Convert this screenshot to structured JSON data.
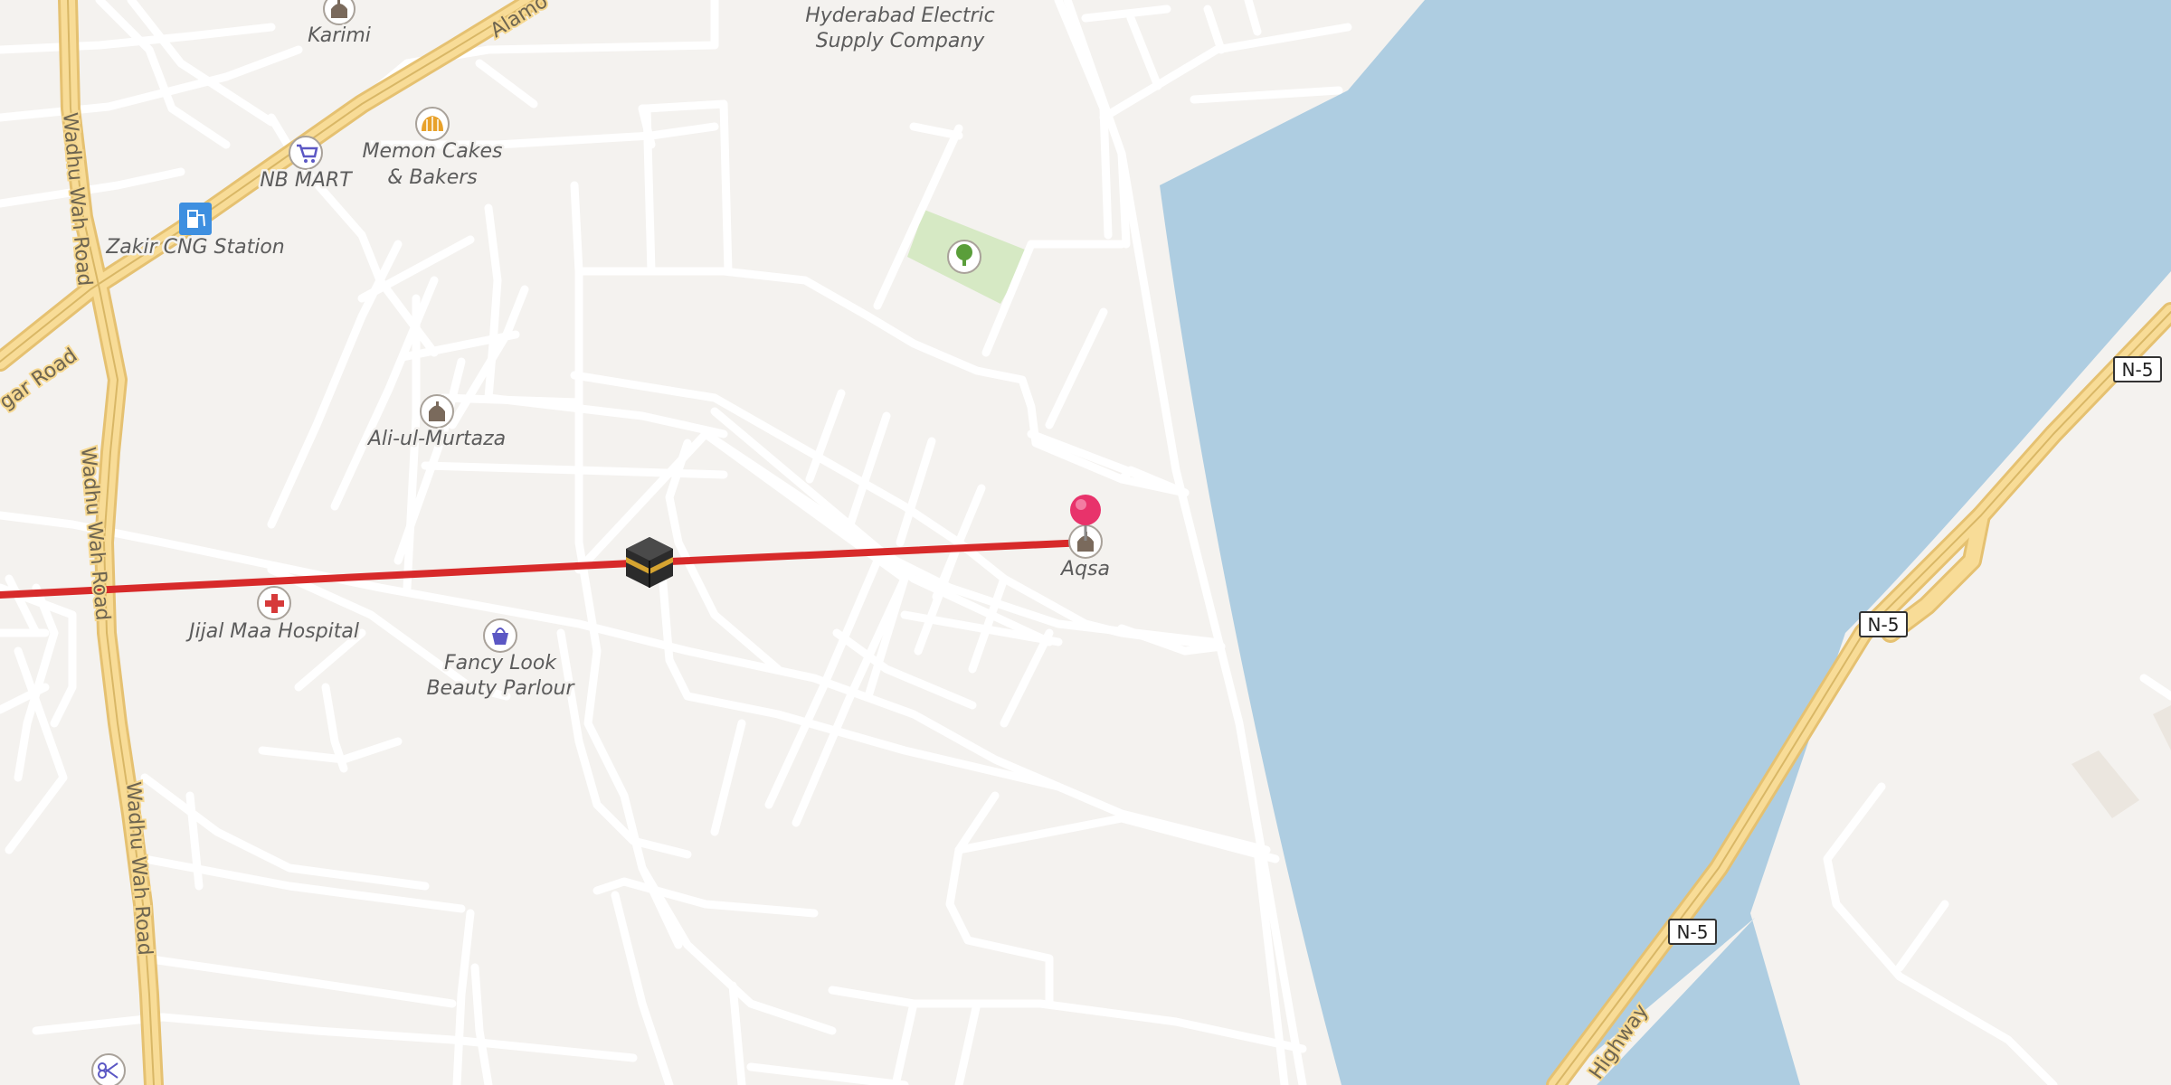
{
  "map": {
    "colors": {
      "land": "#f4f2ef",
      "water": "#aecde1",
      "road_minor": "#ffffff",
      "road_major_fill": "#f6d890",
      "road_major_casing": "#e7c87a",
      "park": "#d6e9c4",
      "route_line": "#d72a2a",
      "pin": "#e8336b"
    },
    "poi": {
      "karimi": "Karimi",
      "hyderabad_electric_1": "Hyderabad Electric",
      "hyderabad_electric_2": "Supply Company",
      "memon_cakes_1": "Memon Cakes",
      "memon_cakes_2": "& Bakers",
      "nb_mart": "NB MART",
      "zakir_cng": "Zakir CNG Station",
      "ali_ul_murtaza": "Ali-ul-Murtaza",
      "aqsa": "Aqsa",
      "jijal_maa": "Jijal Maa Hospital",
      "fancy_look_1": "Fancy Look",
      "fancy_look_2": "Beauty Parlour"
    },
    "roads": {
      "wadhu_wah_1": "Wadhu Wah Road",
      "wadhu_wah_2": "Wadhu Wah Road",
      "wadhu_wah_3": "Wadhu Wah Road",
      "alamo": "Alamo",
      "gar_road": "gar Road",
      "highway": "Highway"
    },
    "shields": {
      "n5_a": "N-5",
      "n5_b": "N-5",
      "n5_c": "N-5"
    },
    "icons": {
      "mosque": "mosque-icon",
      "bakery": "bakery-icon",
      "shopping": "shopping-cart-icon",
      "fuel": "fuel-station-icon",
      "park": "tree-icon",
      "hospital": "hospital-cross-icon",
      "beauty": "shopping-bag-icon",
      "scissors": "scissors-icon",
      "kaaba": "kaaba-icon",
      "pin": "location-pin-icon"
    }
  }
}
